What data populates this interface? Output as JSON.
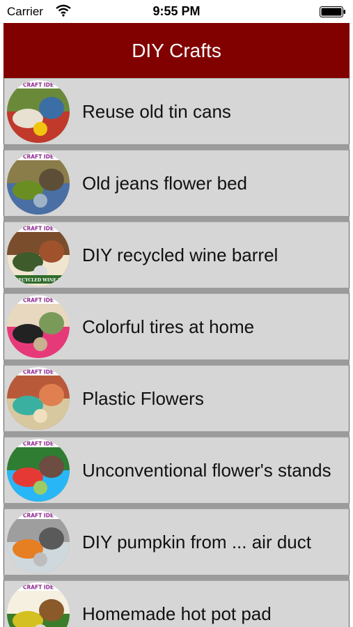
{
  "status_bar": {
    "carrier": "Carrier",
    "time": "9:55 PM"
  },
  "nav": {
    "title": "DIY Crafts"
  },
  "thumb_caption": "CRAFT IDE",
  "colors": {
    "nav_background": "#810000",
    "row_background": "#d6d6d6",
    "separator": "#9b9b9b"
  },
  "items": [
    {
      "label": "Reuse old tin cans",
      "thumb_extra": ""
    },
    {
      "label": "Old jeans flower bed",
      "thumb_extra": ""
    },
    {
      "label": "DIY recycled wine barrel",
      "thumb_extra": "DIY RECYCLED WINE BARR"
    },
    {
      "label": "Colorful tires at home",
      "thumb_extra": ""
    },
    {
      "label": "Plastic Flowers",
      "thumb_extra": ""
    },
    {
      "label": "Unconventional flower's stands",
      "thumb_extra": ""
    },
    {
      "label": "DIY pumpkin from ... air duct",
      "thumb_extra": ""
    },
    {
      "label": "Homemade hot pot pad",
      "thumb_extra": ""
    }
  ]
}
